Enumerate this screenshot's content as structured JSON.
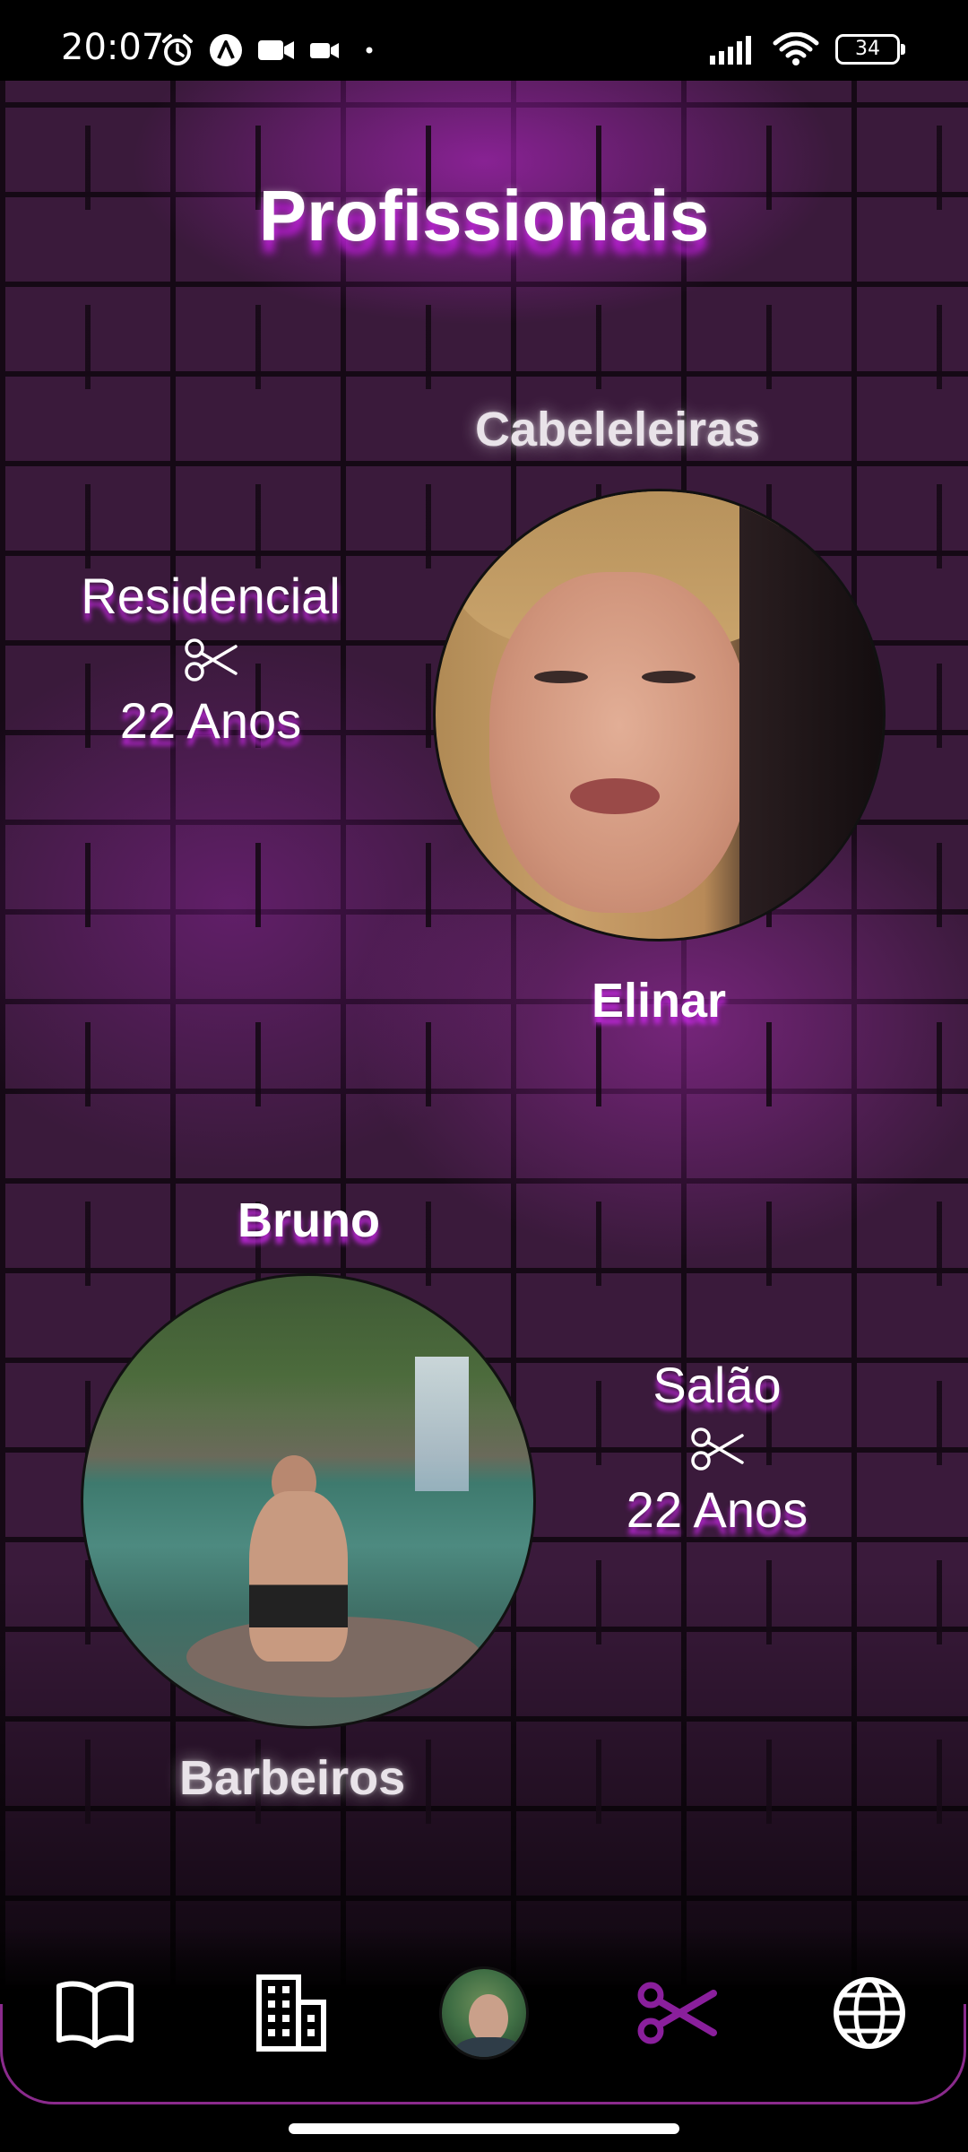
{
  "status_bar": {
    "time": "20:07",
    "battery": "34",
    "left_icons": [
      "alarm-icon",
      "a-badge-icon",
      "video-camera-icon",
      "video-camera-small-icon",
      "dot-icon"
    ],
    "right_icons": [
      "signal-icon",
      "wifi-icon",
      "battery-icon"
    ]
  },
  "page": {
    "title": "Profissionais"
  },
  "professionals": [
    {
      "category": "Cabeleleiras",
      "name": "Elinar",
      "work_type": "Residencial",
      "experience": "22 Anos",
      "icon": "scissors-icon"
    },
    {
      "category": "Barbeiros",
      "name": "Bruno",
      "work_type": "Salão",
      "experience": "22 Anos",
      "icon": "scissors-icon"
    }
  ],
  "bottom_nav": {
    "items": [
      {
        "icon": "book-icon",
        "active": false
      },
      {
        "icon": "building-icon",
        "active": false
      },
      {
        "icon": "profile-avatar",
        "active": false
      },
      {
        "icon": "scissors-icon",
        "active": true
      },
      {
        "icon": "globe-icon",
        "active": false
      }
    ]
  },
  "colors": {
    "accent": "#8a1f9c",
    "wall": "#3a1a3b",
    "glow": "#c828e6",
    "nav_border": "#8a2a8c"
  }
}
